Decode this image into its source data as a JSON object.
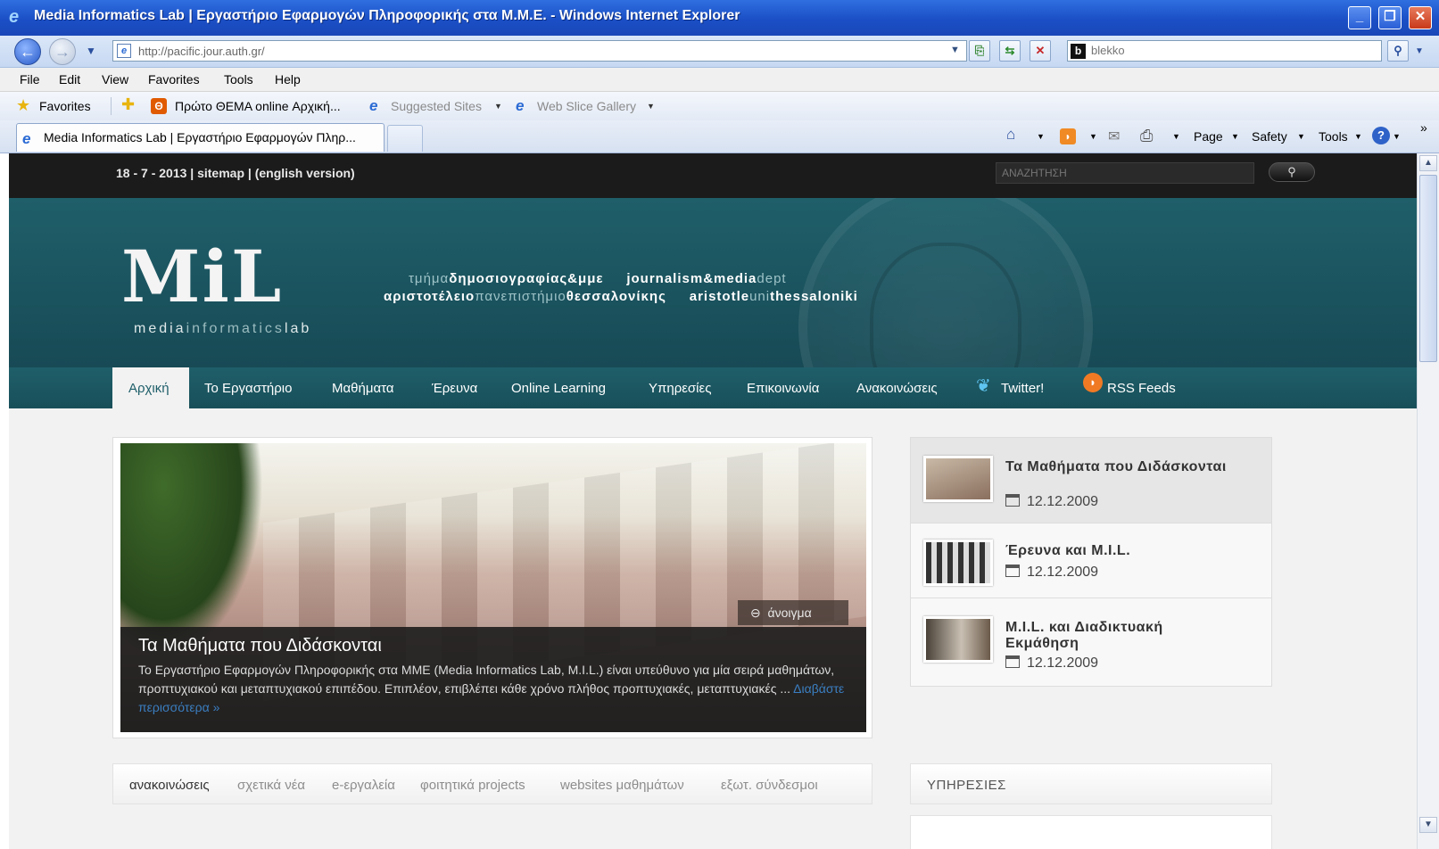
{
  "window": {
    "title": "Media Informatics Lab | Εργαστήριο Εφαρμογών Πληροφορικής στα Μ.Μ.Ε. - Windows Internet Explorer",
    "minimize": "_",
    "restore": "❐",
    "close": "✕"
  },
  "address": {
    "url": "http://pacific.jour.auth.gr/",
    "search_placeholder": "blekko",
    "search_logo": "b"
  },
  "menu": [
    "File",
    "Edit",
    "View",
    "Favorites",
    "Tools",
    "Help"
  ],
  "favorites": {
    "label": "Favorites",
    "items": [
      "Πρώτο ΘΕΜΑ online Αρχική...",
      "Suggested Sites",
      "Web Slice Gallery"
    ]
  },
  "tab": {
    "title": "Media Informatics Lab | Εργαστήριο Εφαρμογών Πληρ..."
  },
  "commandbar": {
    "page": "Page",
    "safety": "Safety",
    "tools": "Tools"
  },
  "site": {
    "top": {
      "date": "18 - 7 - 2013 | sitemap | (english version)",
      "search_placeholder": "ΑΝΑΖΗΤΗΣΗ"
    },
    "logo": {
      "letters": "MiL",
      "sub_a": "media",
      "sub_b": "informatics",
      "sub_c": "lab"
    },
    "tagline": {
      "l1a": "τμήμα",
      "l1b": "δημοσιογραφίας&μμε",
      "l1c": "journalism&media",
      "l1d": "dept",
      "l2a": "αριστοτέλειο",
      "l2b": "πανεπιστήμιο",
      "l2c": "θεσσαλονίκης",
      "l2d": "aristotle",
      "l2e": "uni",
      "l2f": "thessaloniki"
    },
    "nav": [
      "Αρχική",
      "Το Εργαστήριο",
      "Μαθήματα",
      "Έρευνα",
      "Online Learning",
      "Υπηρεσίες",
      "Επικοινωνία",
      "Ανακοινώσεις",
      "Twitter!",
      "RSS Feeds"
    ],
    "slider": {
      "open_label": "άνοιγμα",
      "title": "Τα Μαθήματα που Διδάσκονται",
      "text": "Το Εργαστήριο Εφαρμογών Πληροφορικής στα ΜΜΕ (Media Informatics Lab, M.I.L.) είναι υπεύθυνο για μία σειρά μαθημάτων, προπτυχιακού και μεταπτυχιακού επιπέδου. Επιπλέον, επιβλέπει κάθε χρόνο πλήθος προπτυχιακές, μεταπτυχιακές ...",
      "more": "Διαβάστε περισσότερα »"
    },
    "side_items": [
      {
        "title": "Τα Μαθήματα που Διδάσκονται",
        "date": "12.12.2009"
      },
      {
        "title": "Έρευνα και M.I.L.",
        "date": "12.12.2009"
      },
      {
        "title": "M.I.L. και Διαδικτυακή Εκμάθηση",
        "date": "12.12.2009"
      }
    ],
    "content_tabs": [
      "ανακοινώσεις",
      "σχετικά νέα",
      "e-εργαλεία",
      "φοιτητικά projects",
      "websites μαθημάτων",
      "εξωτ. σύνδεσμοι"
    ],
    "services_title": "ΥΠΗΡΕΣΙΕΣ"
  }
}
